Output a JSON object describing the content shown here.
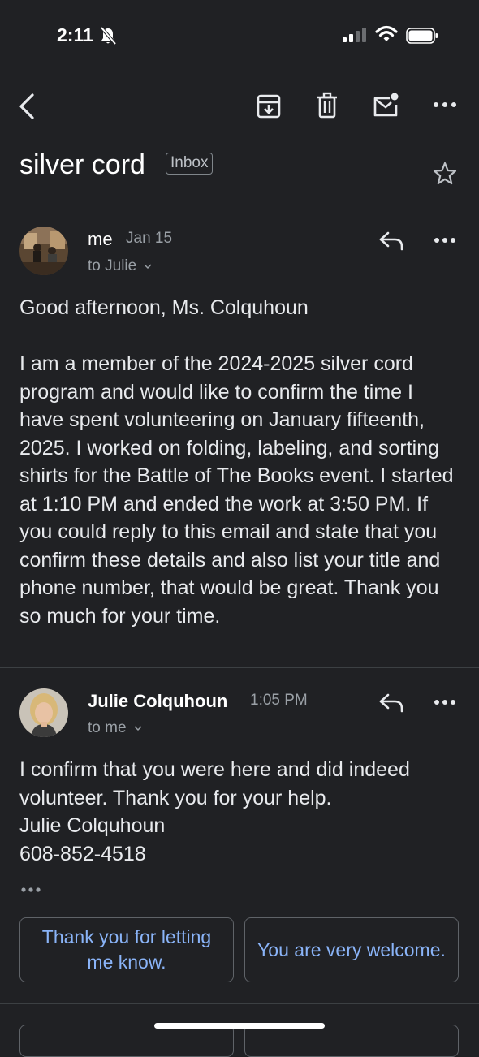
{
  "status_bar": {
    "time": "2:11"
  },
  "subject": "silver cord",
  "label": "Inbox",
  "messages": [
    {
      "sender": "me",
      "date": "Jan 15",
      "to": "to Julie",
      "body": "Good afternoon, Ms. Colquhoun\n\nI am a member of the 2024-2025 silver cord program and would like to confirm the time I have spent volunteering on January fifteenth, 2025. I worked on folding, labeling, and sorting shirts for the Battle of The Books event. I started at 1:10 PM and ended the work at 3:50 PM. If you could reply to this email and state that you confirm these details and also list your title and phone number, that would be great. Thank you so much for your time."
    },
    {
      "sender": "Julie Colquhoun",
      "date": "1:05 PM",
      "to": "to me",
      "body": "I confirm that you were here and did indeed volunteer.  Thank you for your help.\nJulie Colquhoun\n608-852-4518"
    }
  ],
  "smart_replies": [
    "Thank you for letting me know.",
    "You are very welcome."
  ],
  "colors": {
    "background": "#202124",
    "accent": "#8ab4f8",
    "secondary_text": "#9aa0a6"
  }
}
